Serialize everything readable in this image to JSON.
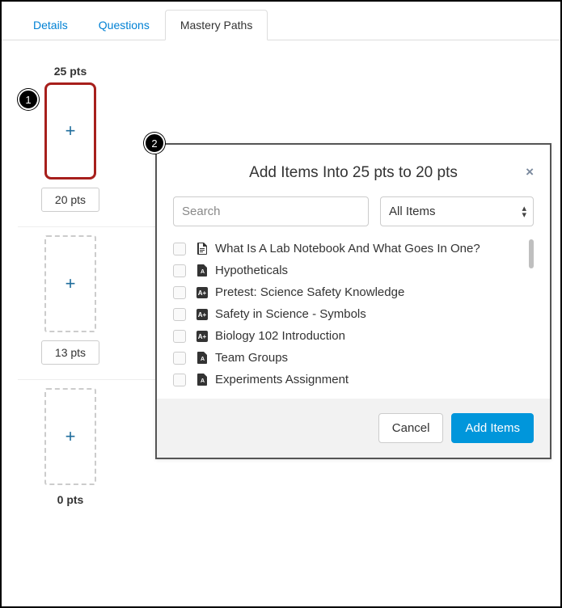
{
  "tabs": {
    "details": "Details",
    "questions": "Questions",
    "mastery": "Mastery Paths"
  },
  "ranges": {
    "top_pts": "25 pts",
    "mid_pts": "20 pts",
    "low_pts": "13 pts",
    "bottom_pts": "0 pts"
  },
  "badge": {
    "one": "1",
    "two": "2"
  },
  "modal": {
    "title": "Add Items Into 25 pts to 20 pts",
    "search_placeholder": "Search",
    "filter_selected": "All Items",
    "items": [
      {
        "label": "What Is A Lab Notebook And What Goes In One?",
        "icon": "page"
      },
      {
        "label": "Hypotheticals",
        "icon": "assignment"
      },
      {
        "label": "Pretest: Science Safety Knowledge",
        "icon": "quiz"
      },
      {
        "label": "Safety in Science - Symbols",
        "icon": "quiz"
      },
      {
        "label": "Biology 102 Introduction",
        "icon": "quiz"
      },
      {
        "label": "Team Groups",
        "icon": "assignment"
      },
      {
        "label": "Experiments Assignment",
        "icon": "assignment"
      }
    ],
    "cancel": "Cancel",
    "add": "Add Items"
  }
}
